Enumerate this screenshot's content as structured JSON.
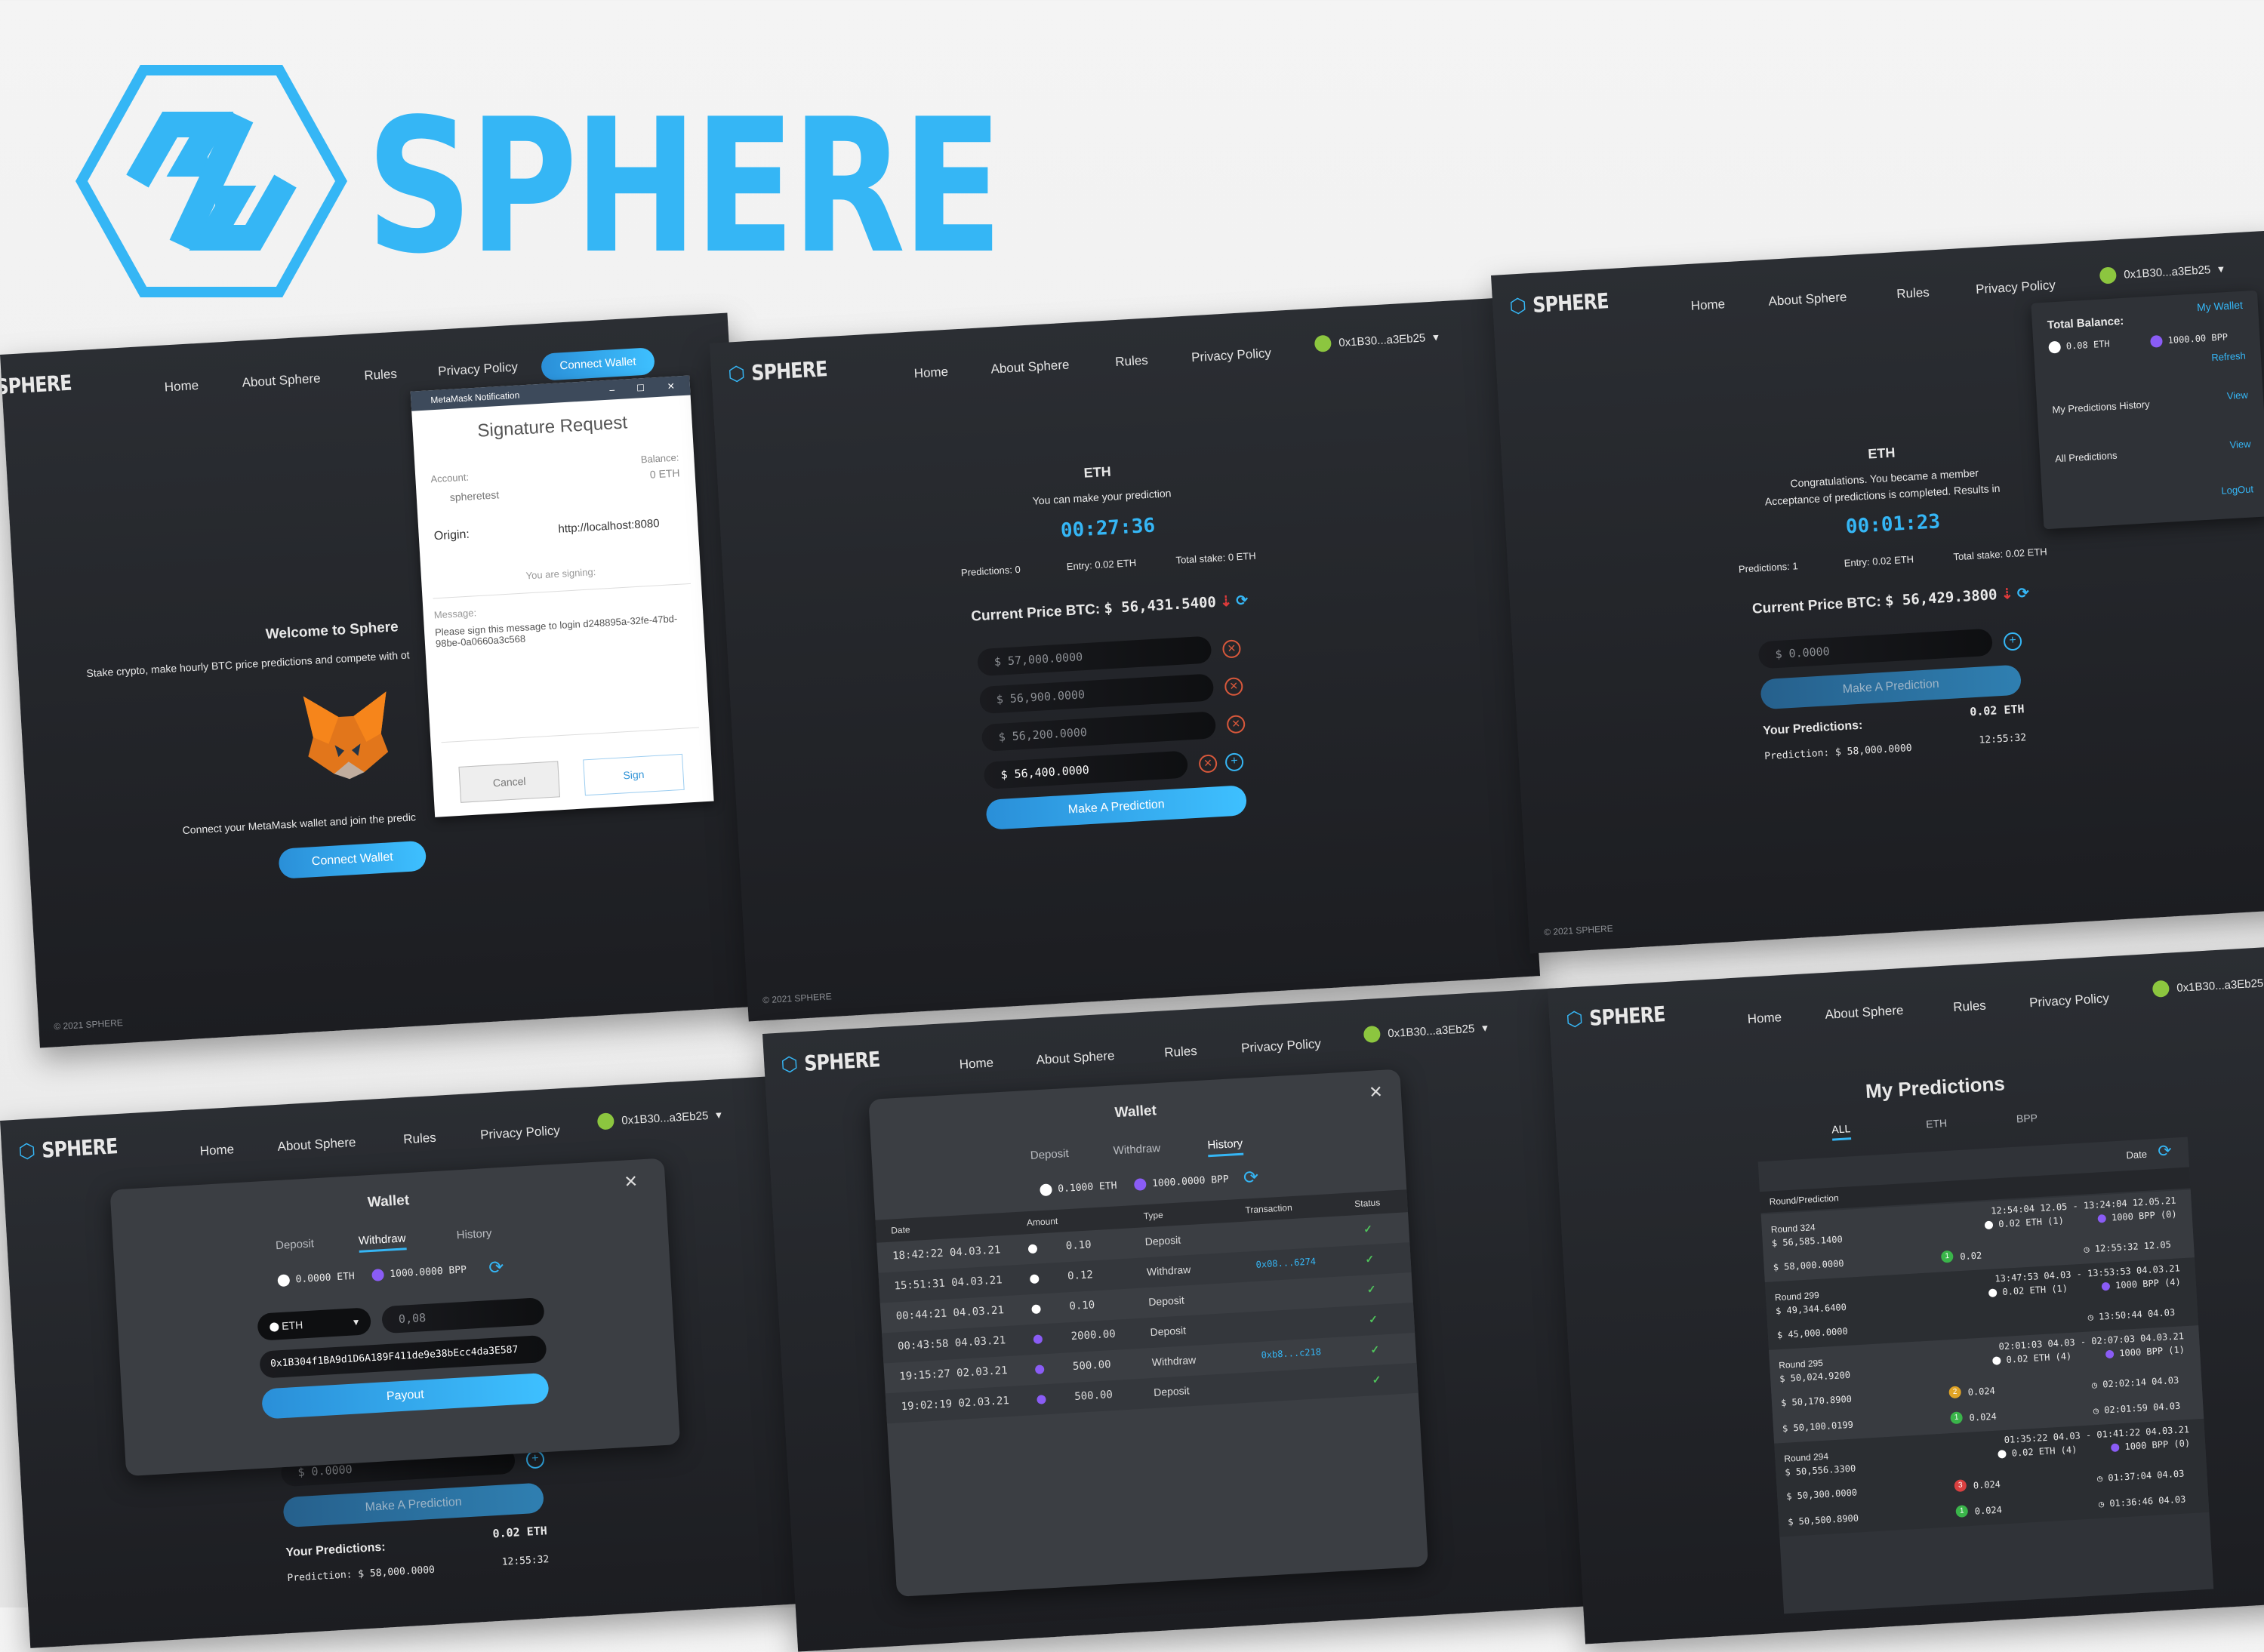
{
  "brand": {
    "name": "SPHERE",
    "color": "#35b6f5"
  },
  "nav": {
    "home": "Home",
    "about": "About Sphere",
    "rules": "Rules",
    "privacy": "Privacy Policy",
    "connect": "Connect Wallet",
    "account": "0x1B30...a3Eb25"
  },
  "footer": "© 2021 SPHERE",
  "login": {
    "title": "Welcome to Sphere",
    "subtitle": "Stake crypto, make hourly BTC price predictions and compete with ot",
    "connect_text": "Connect your MetaMask wallet and join the predic",
    "connect_btn": "Connect Wallet",
    "metamask": {
      "window_title": "MetaMask Notification",
      "heading": "Signature Request",
      "account_label": "Account:",
      "account_value": "spheretest",
      "balance_label": "Balance:",
      "balance_value": "0 ETH",
      "origin_label": "Origin:",
      "origin_value": "http://localhost:8080",
      "signing": "You are signing:",
      "message_label": "Message:",
      "message_value": "Please sign this message to login d248895a-32fe-47bd-98be-0a0660a3c568",
      "cancel": "Cancel",
      "sign": "Sign"
    }
  },
  "predict": {
    "coin": "ETH",
    "hint": "You can make your prediction",
    "timer": "00:27:36",
    "stats": {
      "predictions": "Predictions: 0",
      "entry": "Entry: 0.02 ETH",
      "stake": "Total stake: 0 ETH"
    },
    "price_label": "Current Price BTC:",
    "price_value": "$ 56,431.5400",
    "inputs": [
      "$ 57,000.0000",
      "$ 56,900.0000",
      "$ 56,200.0000",
      "$ 56,400.0000"
    ],
    "button": "Make A Prediction"
  },
  "member": {
    "coin": "ETH",
    "msg1": "Congratulations. You became a member",
    "msg2": "Acceptance of predictions is completed. Results in",
    "timer": "00:01:23",
    "stats": {
      "predictions": "Predictions: 1",
      "entry": "Entry: 0.02 ETH",
      "stake": "Total stake: 0.02 ETH"
    },
    "price_label": "Current Price BTC:",
    "price_value": "$ 56,429.3800",
    "input": "$ 0.0000",
    "button": "Make A Prediction",
    "your": "Your Predictions:",
    "your_amount": "0.02 ETH",
    "pred_label": "Prediction: $ 58,000.0000",
    "pred_time": "12:55:32",
    "menu": {
      "balance_title": "Total Balance:",
      "my_wallet": "My Wallet",
      "eth": "0.08 ETH",
      "bpp": "1000.00 BPP",
      "refresh": "Refresh",
      "history": "My Predictions History",
      "history_view": "View",
      "all": "All Predictions",
      "all_view": "View",
      "logout": "LogOut"
    }
  },
  "withdraw": {
    "title": "Wallet",
    "tabs": [
      "Deposit",
      "Withdraw",
      "History"
    ],
    "eth": "0.0000 ETH",
    "bpp": "1000.0000 BPP",
    "select": "ETH",
    "amount": "0,08",
    "address": "0x1B304f1BA9d1D6A189F411de9e38bEcc4da3E587",
    "payout": "Payout",
    "bg_input": "$ 0.0000",
    "bg_button": "Make A Prediction",
    "your": "Your Predictions:",
    "your_amount": "0.02 ETH",
    "pred_label": "Prediction: $ 58,000.0000",
    "pred_time": "12:55:32"
  },
  "history": {
    "title": "Wallet",
    "tabs": [
      "Deposit",
      "Withdraw",
      "History"
    ],
    "eth": "0.1000 ETH",
    "bpp": "1000.0000 BPP",
    "columns": [
      "Date",
      "Amount",
      "Type",
      "Transaction",
      "Status"
    ],
    "rows": [
      {
        "date": "18:42:22 04.03.21",
        "coin": "eth",
        "amount": "0.10",
        "type": "Deposit",
        "tx": ""
      },
      {
        "date": "15:51:31 04.03.21",
        "coin": "eth",
        "amount": "0.12",
        "type": "Withdraw",
        "tx": "0x08...6274"
      },
      {
        "date": "00:44:21 04.03.21",
        "coin": "eth",
        "amount": "0.10",
        "type": "Deposit",
        "tx": ""
      },
      {
        "date": "00:43:58 04.03.21",
        "coin": "bpp",
        "amount": "2000.00",
        "type": "Deposit",
        "tx": ""
      },
      {
        "date": "19:15:27 02.03.21",
        "coin": "bpp",
        "amount": "500.00",
        "type": "Withdraw",
        "tx": "0xb8...c218"
      },
      {
        "date": "19:02:19 02.03.21",
        "coin": "bpp",
        "amount": "500.00",
        "type": "Deposit",
        "tx": ""
      }
    ]
  },
  "mypred": {
    "title": "My Predictions",
    "tabs": [
      "ALL",
      "ETH",
      "BPP"
    ],
    "sort": "Date",
    "col": "Round/Prediction",
    "rounds": [
      {
        "round": "Round 324",
        "price": "$ 56,585.1400",
        "range": "12:54:04 12.05 - 13:24:04 12.05.21",
        "stake": "0.02 ETH (1)",
        "bpp": "1000 BPP (0)",
        "preds": [
          {
            "value": "$ 58,000.0000",
            "rank": "1",
            "amount": "0.02",
            "time": "12:55:32 12.05"
          }
        ]
      },
      {
        "round": "Round 299",
        "price": "$ 49,344.6400",
        "range": "13:47:53 04.03 - 13:53:53 04.03.21",
        "stake": "0.02 ETH (1)",
        "bpp": "1000 BPP (4)",
        "preds": [
          {
            "value": "$ 45,000.0000",
            "rank": "",
            "amount": "",
            "time": "13:50:44 04.03"
          }
        ]
      },
      {
        "round": "Round 295",
        "price": "$ 50,024.9200",
        "range": "02:01:03 04.03 - 02:07:03 04.03.21",
        "stake": "0.02 ETH (4)",
        "bpp": "1000 BPP (1)",
        "preds": [
          {
            "value": "$ 50,170.8900",
            "rank": "2",
            "amount": "0.024",
            "time": "02:02:14 04.03"
          },
          {
            "value": "$ 50,100.0199",
            "rank": "1",
            "amount": "0.024",
            "time": "02:01:59 04.03"
          }
        ]
      },
      {
        "round": "Round 294",
        "price": "$ 50,556.3300",
        "range": "01:35:22 04.03 - 01:41:22 04.03.21",
        "stake": "0.02 ETH (4)",
        "bpp": "1000 BPP (0)",
        "preds": [
          {
            "value": "$ 50,300.0000",
            "rank": "3",
            "amount": "0.024",
            "time": "01:37:04 04.03"
          },
          {
            "value": "$ 50,500.8900",
            "rank": "1",
            "amount": "0.024",
            "time": "01:36:46 04.03"
          }
        ]
      }
    ]
  }
}
